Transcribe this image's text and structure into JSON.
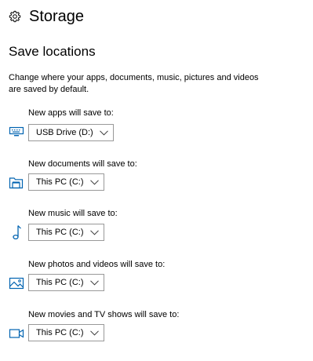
{
  "header": {
    "title": "Storage",
    "icon": "gear-icon"
  },
  "section": {
    "title": "Save locations",
    "description": "Change where your apps, documents, music, pictures and videos are saved by default."
  },
  "accent_color": "#0063b1",
  "rows": [
    {
      "label": "New apps will save to:",
      "value": "USB Drive (D:)",
      "icon": "monitor-icon"
    },
    {
      "label": "New documents will save to:",
      "value": "This PC (C:)",
      "icon": "folder-icon"
    },
    {
      "label": "New music will save to:",
      "value": "This PC (C:)",
      "icon": "music-note-icon"
    },
    {
      "label": "New photos and videos will save to:",
      "value": "This PC (C:)",
      "icon": "picture-icon"
    },
    {
      "label": "New movies and TV shows will save to:",
      "value": "This PC (C:)",
      "icon": "video-camera-icon"
    }
  ]
}
